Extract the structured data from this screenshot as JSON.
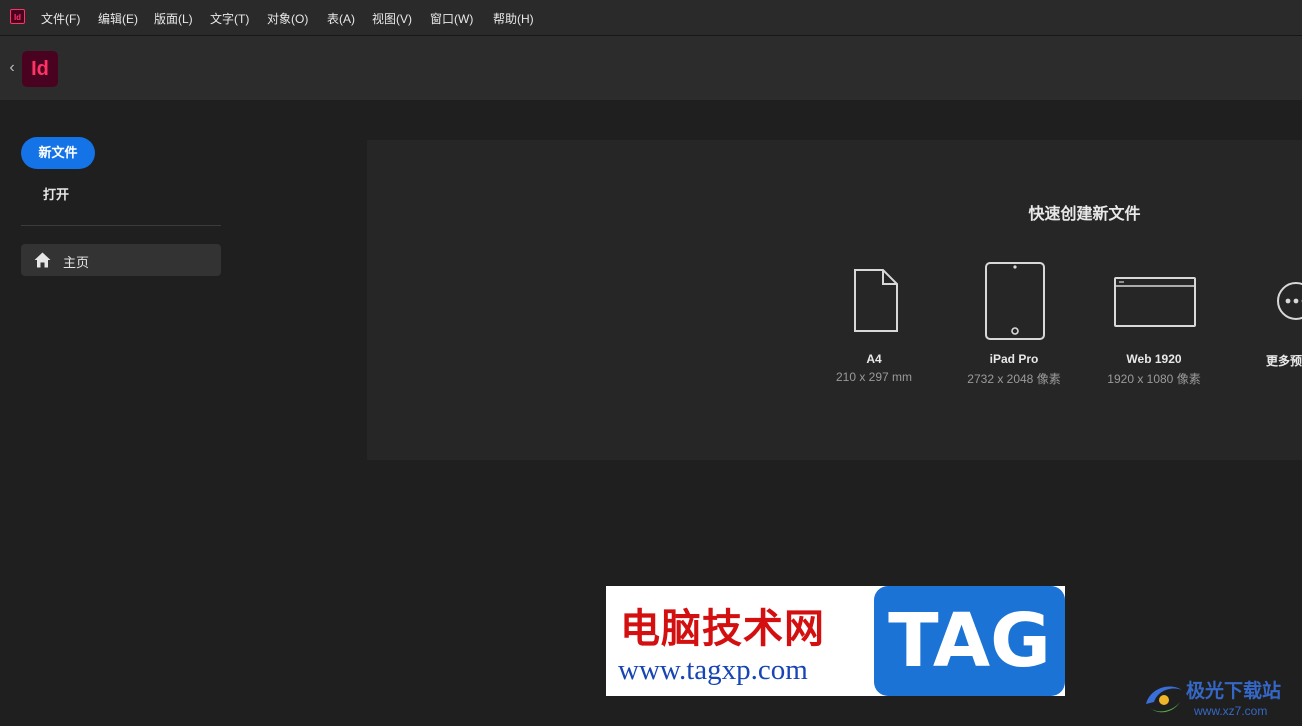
{
  "app": {
    "mini_logo": "Id",
    "logo": "Id",
    "brand_color": "#ff3366"
  },
  "menu": [
    "文件(F)",
    "编辑(E)",
    "版面(L)",
    "文字(T)",
    "对象(O)",
    "表(A)",
    "视图(V)",
    "窗口(W)",
    "帮助(H)"
  ],
  "header": {
    "back": "‹"
  },
  "nav": {
    "new_file": "新文件",
    "open": "打开",
    "home": "主页",
    "accent": "#1473e6"
  },
  "quick_create": {
    "title": "快速创建新文件",
    "presets": [
      {
        "name": "A4",
        "size": "210 x 297 mm",
        "icon": "page-icon"
      },
      {
        "name": "iPad Pro",
        "size": "2732 x 2048 像素",
        "icon": "tablet-icon"
      },
      {
        "name": "Web 1920",
        "size": "1920 x 1080 像素",
        "icon": "browser-window-icon"
      },
      {
        "name": "更多预设",
        "size": "",
        "icon": "more-icon"
      }
    ]
  },
  "watermark": {
    "cn": "电脑技术网",
    "url": "www.tagxp.com",
    "tag": "TAG"
  },
  "corner_watermark": {
    "cn": "极光下载站",
    "url": "www.xz7.com"
  }
}
